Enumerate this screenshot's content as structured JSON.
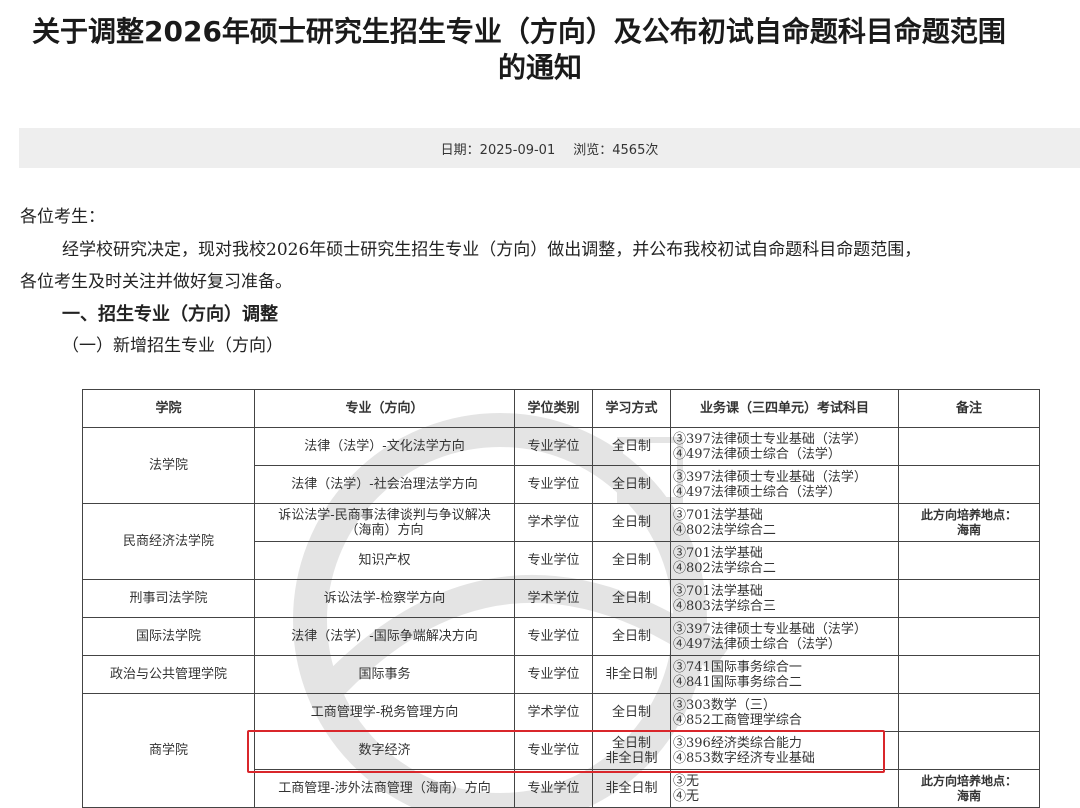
{
  "article": {
    "title_line1": "关于调整2026年硕士研究生招生专业（方向）及公布初试自命题科目命题范围",
    "title_line2": "的通知",
    "date_label": "日期：",
    "date": "2025-09-01",
    "views_label": "浏览：",
    "views": "4565次"
  },
  "content": {
    "salutation": "各位考生：",
    "para1_line1": "经学校研究决定，现对我校2026年硕士研究生招生专业（方向）做出调整，并公布我校初试自命题科目命题范围，",
    "para1_line2": "各位考生及时关注并做好复习准备。",
    "section1": "一、招生专业（方向）调整",
    "subsection1": "（一）新增招生专业（方向）"
  },
  "table": {
    "headers": [
      "学院",
      "专业（方向）",
      "学位类别",
      "学习方式",
      "业务课（三四单元）考试科目",
      "备注"
    ],
    "colleges": [
      "法学院",
      "民商经济法学院",
      "刑事司法学院",
      "国际法学院",
      "政治与公共管理学院",
      "商学院"
    ],
    "rows": [
      {
        "major": "法律（法学）-文化法学方向",
        "degree": "专业学位",
        "mode": "全日制",
        "s1": "③397法律硕士专业基础（法学）",
        "s2": "④497法律硕士综合（法学）",
        "note": ""
      },
      {
        "major": "法律（法学）-社会治理法学方向",
        "degree": "专业学位",
        "mode": "全日制",
        "s1": "③397法律硕士专业基础（法学）",
        "s2": "④497法律硕士综合（法学）",
        "note": ""
      },
      {
        "major": "诉讼法学-民商事法律谈判与争议解决（海南）方向",
        "major_l1": "诉讼法学-民商事法律谈判与争议解决",
        "major_l2": "（海南）方向",
        "degree": "学术学位",
        "mode": "全日制",
        "s1": "③701法学基础",
        "s2": "④802法学综合二",
        "note_l1": "此方向培养地点：",
        "note_l2": "海南"
      },
      {
        "major": "知识产权",
        "degree": "专业学位",
        "mode": "全日制",
        "s1": "③701法学基础",
        "s2": "④802法学综合二",
        "note": ""
      },
      {
        "major": "诉讼法学-检察学方向",
        "degree": "学术学位",
        "mode": "全日制",
        "s1": "③701法学基础",
        "s2": "④803法学综合三",
        "note": ""
      },
      {
        "major": "法律（法学）-国际争端解决方向",
        "degree": "专业学位",
        "mode": "全日制",
        "s1": "③397法律硕士专业基础（法学）",
        "s2": "④497法律硕士综合（法学）",
        "note": ""
      },
      {
        "major": "国际事务",
        "degree": "专业学位",
        "mode": "非全日制",
        "s1": "③741国际事务综合一",
        "s2": "④841国际事务综合二",
        "note": ""
      },
      {
        "major": "工商管理学-税务管理方向",
        "degree": "学术学位",
        "mode": "全日制",
        "s1": "③303数学（三）",
        "s2": "④852工商管理学综合",
        "note": ""
      },
      {
        "major": "数字经济",
        "degree": "专业学位",
        "mode_l1": "全日制",
        "mode_l2": "非全日制",
        "s1": "③396经济类综合能力",
        "s2": "④853数字经济专业基础",
        "note": ""
      },
      {
        "major": "工商管理-涉外法商管理（海南）方向",
        "degree": "专业学位",
        "mode": "非全日制",
        "s1": "③无",
        "s2": "④无",
        "note_l1": "此方向培养地点：",
        "note_l2": "海南"
      }
    ]
  },
  "colors": {
    "highlight": "#d9262b",
    "metabar": "#eeeeee"
  }
}
